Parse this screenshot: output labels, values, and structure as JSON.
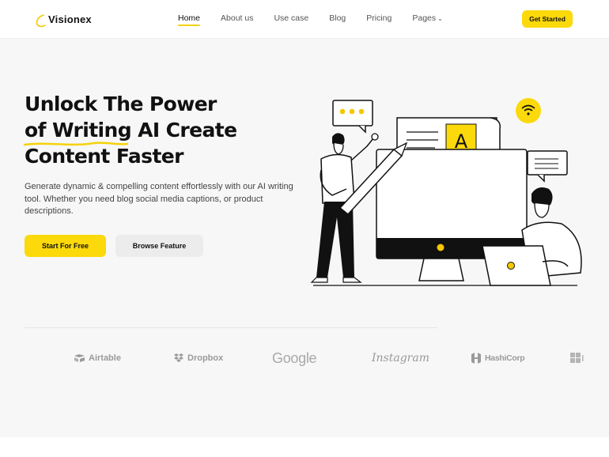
{
  "header": {
    "logo_text": "Visionex",
    "nav": [
      {
        "label": "Home",
        "active": true
      },
      {
        "label": "About us"
      },
      {
        "label": "Use case"
      },
      {
        "label": "Blog"
      },
      {
        "label": "Pricing"
      },
      {
        "label": "Pages",
        "dropdown": true
      }
    ],
    "cta_label": "Get Started"
  },
  "hero": {
    "headline_line1": "Unlock The Power",
    "headline_line2_a": "of Writing",
    "headline_line2_b": "AI Create",
    "headline_line3": "Content Faster",
    "subtitle": "Generate dynamic & compelling content effortlessly with our AI writing tool. Whether you need blog social media captions, or product descriptions.",
    "primary_button": "Start For Free",
    "secondary_button": "Browse Feature",
    "illustration_letter": "A"
  },
  "brands": [
    {
      "name": "Airtable",
      "icon": "airtable-icon"
    },
    {
      "name": "Dropbox",
      "icon": "dropbox-icon"
    },
    {
      "name": "Google",
      "icon": ""
    },
    {
      "name": "Instagram",
      "icon": ""
    },
    {
      "name": "HashiCorp",
      "icon": "hashicorp-icon"
    },
    {
      "name": "",
      "icon": "microsoft-icon"
    }
  ],
  "colors": {
    "accent": "#fbd90b",
    "text": "#111111",
    "muted": "#9a9a9a",
    "background": "#f7f7f7"
  }
}
